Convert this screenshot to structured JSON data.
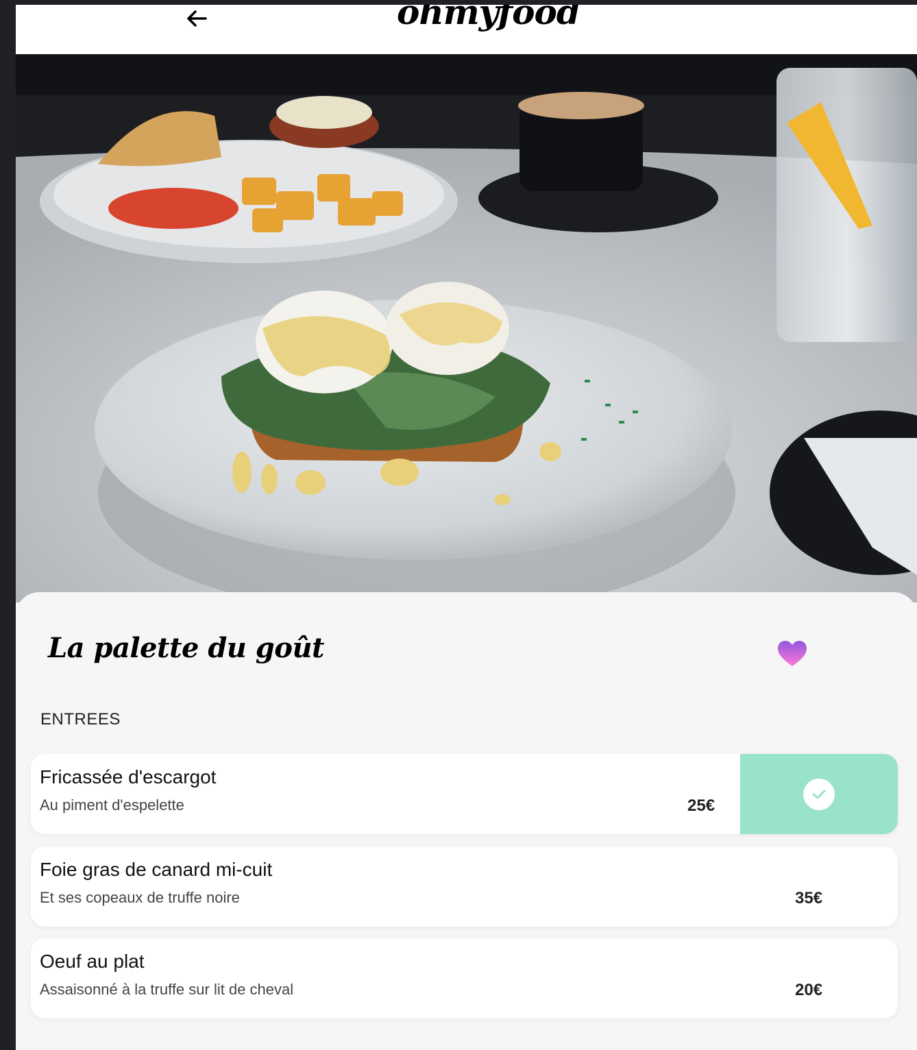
{
  "header": {
    "logo": "ohmyfood",
    "back_icon": "arrow-left-icon"
  },
  "restaurant": {
    "title": "La palette du goût",
    "favorite_icon": "heart-icon",
    "heart_gradient": [
      "#ff79da",
      "#9356dc"
    ]
  },
  "menu": {
    "section_label": "ENTREES",
    "accent_color": "#99e2cb",
    "items": [
      {
        "name": "Fricassée d'escargot",
        "description": "Au piment d'espelette",
        "price": "25€",
        "selected": true
      },
      {
        "name": "Foie gras de canard mi-cuit",
        "description": "Et ses copeaux de truffe noire",
        "price": "35€",
        "selected": false
      },
      {
        "name": "Oeuf au plat",
        "description": "Assaisonné à la truffe sur lit de cheval",
        "price": "20€",
        "selected": false
      }
    ]
  }
}
